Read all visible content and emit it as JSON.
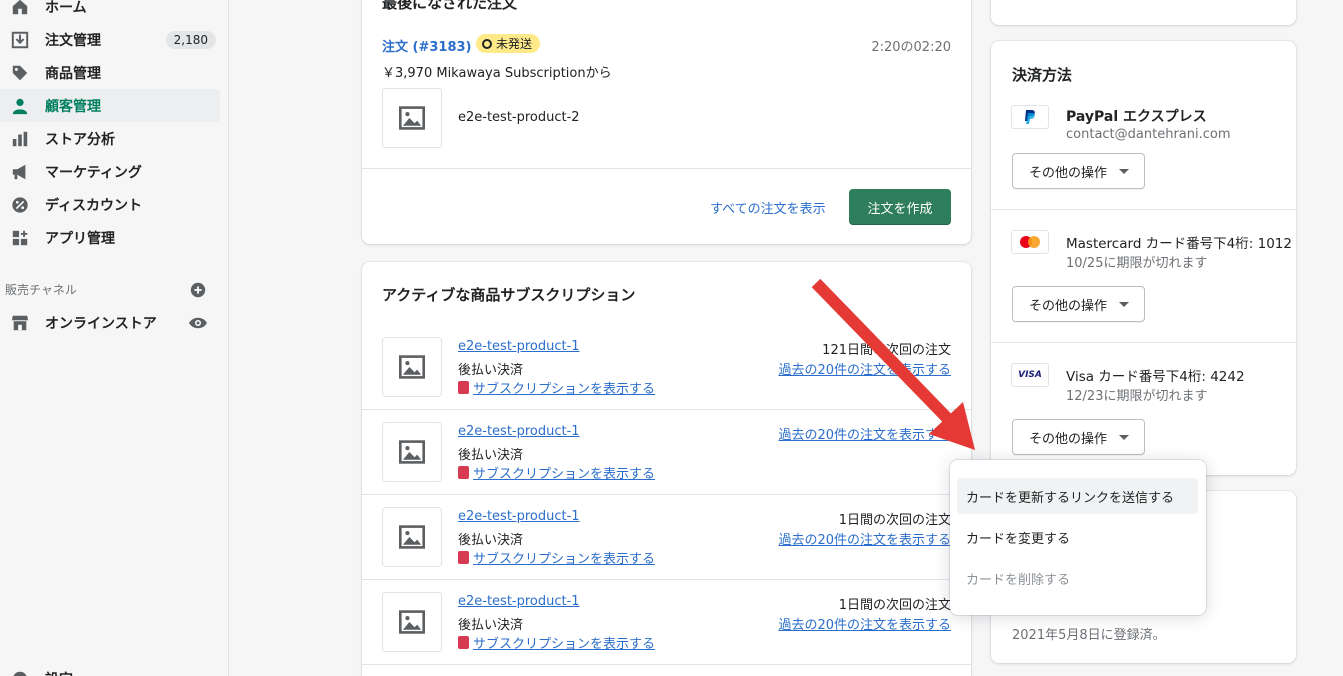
{
  "sidebar": {
    "items": [
      {
        "label": "ホーム",
        "icon": "home-icon"
      },
      {
        "label": "注文管理",
        "icon": "orders-icon",
        "badge": "2,180"
      },
      {
        "label": "商品管理",
        "icon": "tag-icon"
      },
      {
        "label": "顧客管理",
        "icon": "customer-icon",
        "active": true
      },
      {
        "label": "ストア分析",
        "icon": "analytics-icon"
      },
      {
        "label": "マーケティング",
        "icon": "megaphone-icon"
      },
      {
        "label": "ディスカウント",
        "icon": "discount-icon"
      },
      {
        "label": "アプリ管理",
        "icon": "apps-icon"
      }
    ],
    "sales_channels_label": "販売チャネル",
    "online_store_label": "オンラインストア",
    "settings_label": "設定"
  },
  "last_order": {
    "title": "最後になされた注文",
    "order_link": "注文 (#3183)",
    "status": "未発送",
    "time": "2:20の02:20",
    "summary": "￥3,970 Mikawaya Subscriptionから",
    "product": "e2e-test-product-2",
    "view_all": "すべての注文を表示",
    "create_order": "注文を作成"
  },
  "subscriptions": {
    "title": "アクティブな商品サブスクリプション",
    "rows": [
      {
        "product": "e2e-test-product-1",
        "payment": "後払い決済",
        "view": "サブスクリプションを表示する",
        "next": "121日間の次回の注文",
        "past": "過去の20件の注文を表示する"
      },
      {
        "product": "e2e-test-product-1",
        "payment": "後払い決済",
        "view": "サブスクリプションを表示する",
        "next": "",
        "past": "過去の20件の注文を表示する"
      },
      {
        "product": "e2e-test-product-1",
        "payment": "後払い決済",
        "view": "サブスクリプションを表示する",
        "next": "1日間の次回の注文",
        "past": "過去の20件の注文を表示する"
      },
      {
        "product": "e2e-test-product-1",
        "payment": "後払い決済",
        "view": "サブスクリプションを表示する",
        "next": "1日間の次回の注文",
        "past": "過去の20件の注文を表示する"
      }
    ]
  },
  "payment_methods": {
    "title": "決済方法",
    "methods": [
      {
        "name": "PayPal エクスプレス",
        "detail": "contact@dantehrani.com",
        "action": "その他の操作"
      },
      {
        "name": "Mastercard カード番号下4桁: 1012",
        "detail": "10/25に期限が切れます",
        "action": "その他の操作"
      },
      {
        "name": "Visa カード番号下4桁: 4242",
        "detail": "12/23に期限が切れます",
        "action": "その他の操作",
        "visa_label": "VISA"
      }
    ]
  },
  "registered": "2021年5月8日に登録済。",
  "popover": {
    "items": [
      {
        "label": "カードを更新するリンクを送信する",
        "state": "hover"
      },
      {
        "label": "カードを変更する",
        "state": "normal"
      },
      {
        "label": "カードを削除する",
        "state": "disabled"
      }
    ]
  },
  "colors": {
    "accent": "#2e7d5b",
    "link": "#2c6ecb",
    "annotation_arrow": "#e53935"
  }
}
